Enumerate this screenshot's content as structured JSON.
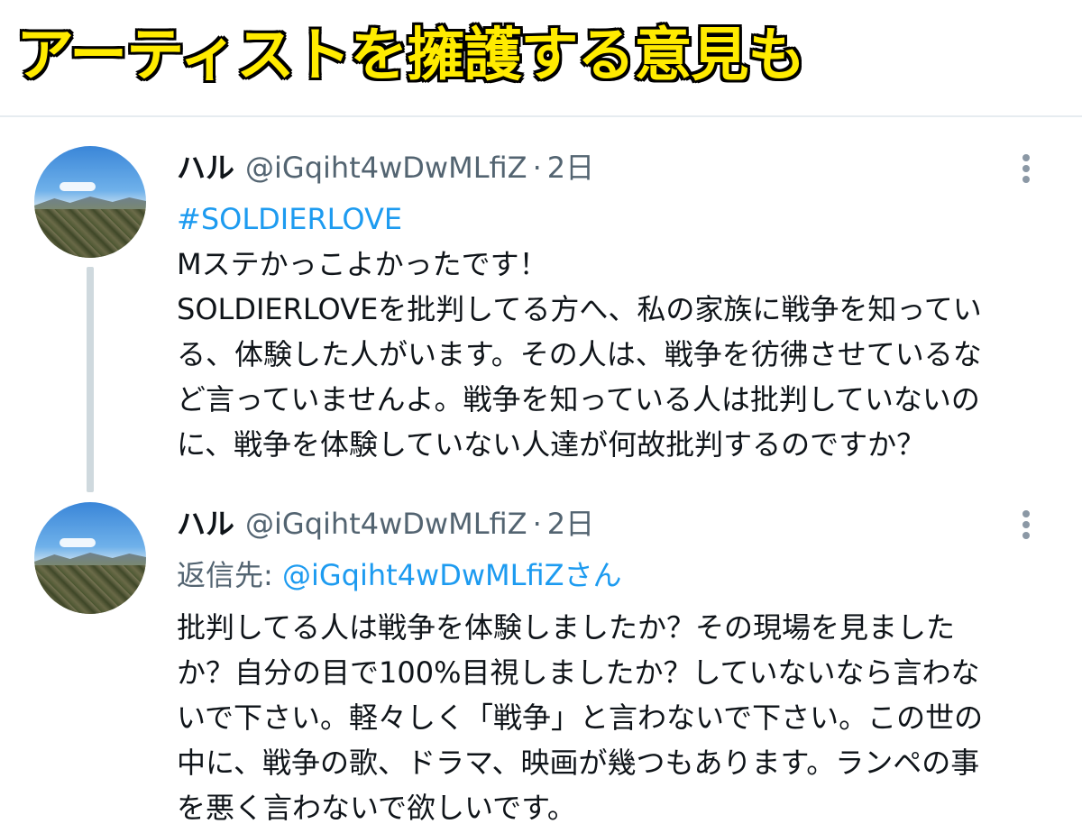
{
  "banner": {
    "title": "アーティストを擁護する意見も"
  },
  "tweets": [
    {
      "display_name": "ハル",
      "handle": "@iGqiht4wDwMLfiZ",
      "separator": "·",
      "time": "2日",
      "hashtag": "#SOLDIERLOVE",
      "lines": [
        "Mステかっこよかったです！",
        "SOLDIERLOVEを批判してる方へ、私の家族に戦争を知ってい",
        "る、体験した人がいます。その人は、戦争を彷彿させているな",
        "ど言っていませんよ。戦争を知っている人は批判していないの",
        "に、戦争を体験していない人達が何故批判するのですか？"
      ]
    },
    {
      "display_name": "ハル",
      "handle": "@iGqiht4wDwMLfiZ",
      "separator": "·",
      "time": "2日",
      "reply_prefix": "返信先: ",
      "reply_mention": "@iGqiht4wDwMLfiZさん",
      "lines": [
        "批判してる人は戦争を体験しましたか？その現場を見ました",
        "か？自分の目で100%目視しましたか？していないなら言わな",
        "いで下さい。軽々しく「戦争」と言わないで下さい。この世の",
        "中に、戦争の歌、ドラマ、映画が幾つもあります。ランペの事",
        "を悪く言わないで欲しいです。"
      ]
    }
  ],
  "icons": {
    "more": "more-vertical-icon",
    "avatar": "avatar-landscape"
  },
  "colors": {
    "banner_text": "#ffeb00",
    "banner_outline": "#000000",
    "link": "#1d9bf0",
    "secondary_text": "#536471",
    "thread_line": "#cfd9de"
  }
}
